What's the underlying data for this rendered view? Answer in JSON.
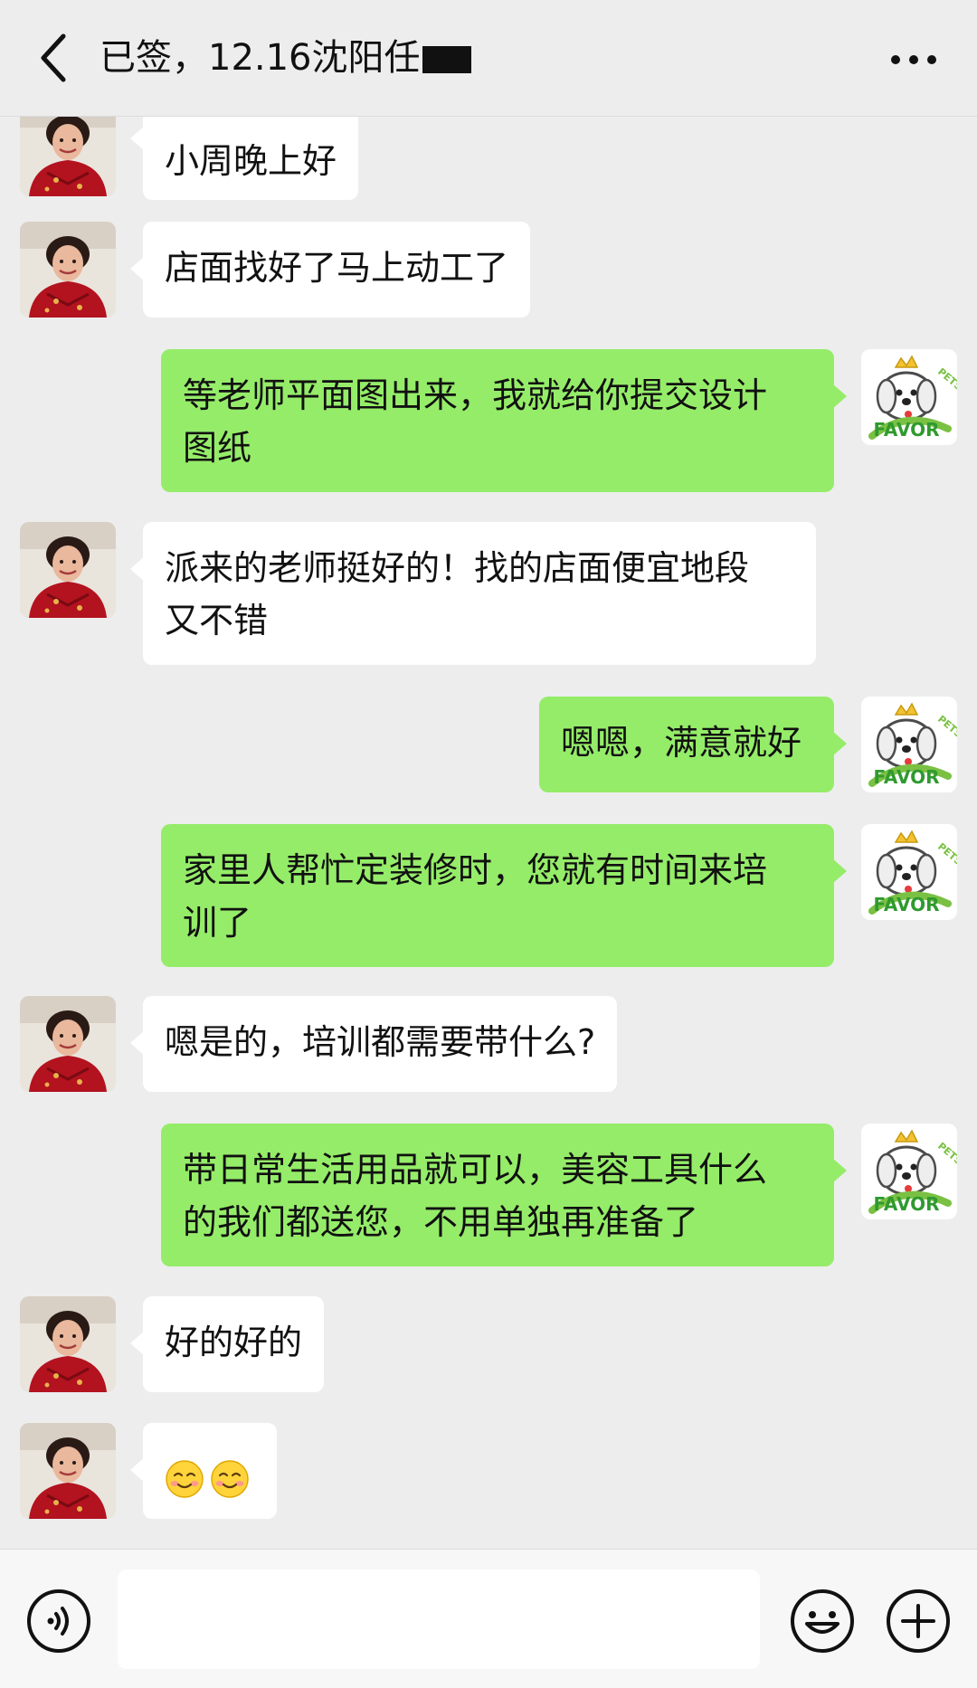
{
  "header": {
    "title": "已签，12.16沈阳任",
    "back_icon": "chevron-left-icon",
    "more_icon": "more-dots-icon"
  },
  "contacts": {
    "left_avatar": "avatar-woman-red-dress",
    "right_avatar": "avatar-dog-favor-logo",
    "right_avatar_text": "FAVOR"
  },
  "messages": [
    {
      "side": "in",
      "text": "小周晚上好"
    },
    {
      "side": "in",
      "text": "店面找好了马上动工了"
    },
    {
      "side": "out",
      "line1": "等老师平面图出来，我就给你提交设计",
      "line2": "图纸"
    },
    {
      "side": "in",
      "line1": "派来的老师挺好的！找的店面便宜地段",
      "line2": "又不错"
    },
    {
      "side": "out",
      "text": "嗯嗯，满意就好"
    },
    {
      "side": "out",
      "line1": "家里人帮忙定装修时，您就有时间来培",
      "line2": "训了"
    },
    {
      "side": "in",
      "text": "嗯是的，培训都需要带什么?"
    },
    {
      "side": "out",
      "line1": "带日常生活用品就可以，美容工具什么",
      "line2": "的我们都送您，不用单独再准备了"
    },
    {
      "side": "in",
      "text": "好的好的"
    },
    {
      "side": "in",
      "emoji": [
        "smiling-face-emoji",
        "smiling-face-emoji"
      ]
    }
  ],
  "input": {
    "voice_icon": "voice-icon",
    "emoji_icon": "emoji-face-icon",
    "plus_icon": "plus-circle-icon",
    "value": ""
  },
  "colors": {
    "background": "#ededed",
    "incoming_bubble": "#ffffff",
    "outgoing_bubble": "#95ec69",
    "text": "#111111"
  }
}
